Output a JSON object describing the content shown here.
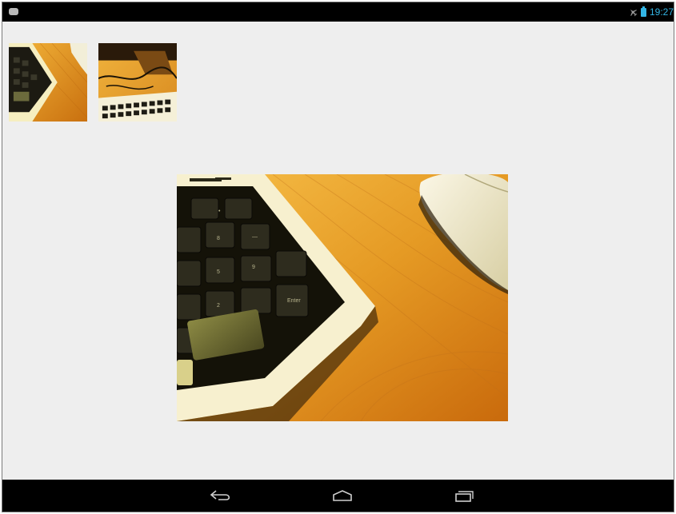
{
  "status_bar": {
    "notification_icon": "notification-icon",
    "airplane_icon": "airplane-mode-icon",
    "battery_icon": "battery-icon",
    "time": "19:27",
    "accent_color": "#33b5e5",
    "background": "#000000"
  },
  "gallery": {
    "background": "#eeeeee",
    "thumbnails": [
      {
        "id": "thumb-1",
        "subject": "keyboard-corner-photo"
      },
      {
        "id": "thumb-2",
        "subject": "keyboard-cables-photo"
      }
    ],
    "selected_photo": {
      "subject": "keyboard-and-mouse-on-wooden-desk"
    }
  },
  "navigation_bar": {
    "buttons": [
      {
        "icon": "back-icon"
      },
      {
        "icon": "home-icon"
      },
      {
        "icon": "recent-apps-icon"
      }
    ],
    "background": "#000000"
  }
}
